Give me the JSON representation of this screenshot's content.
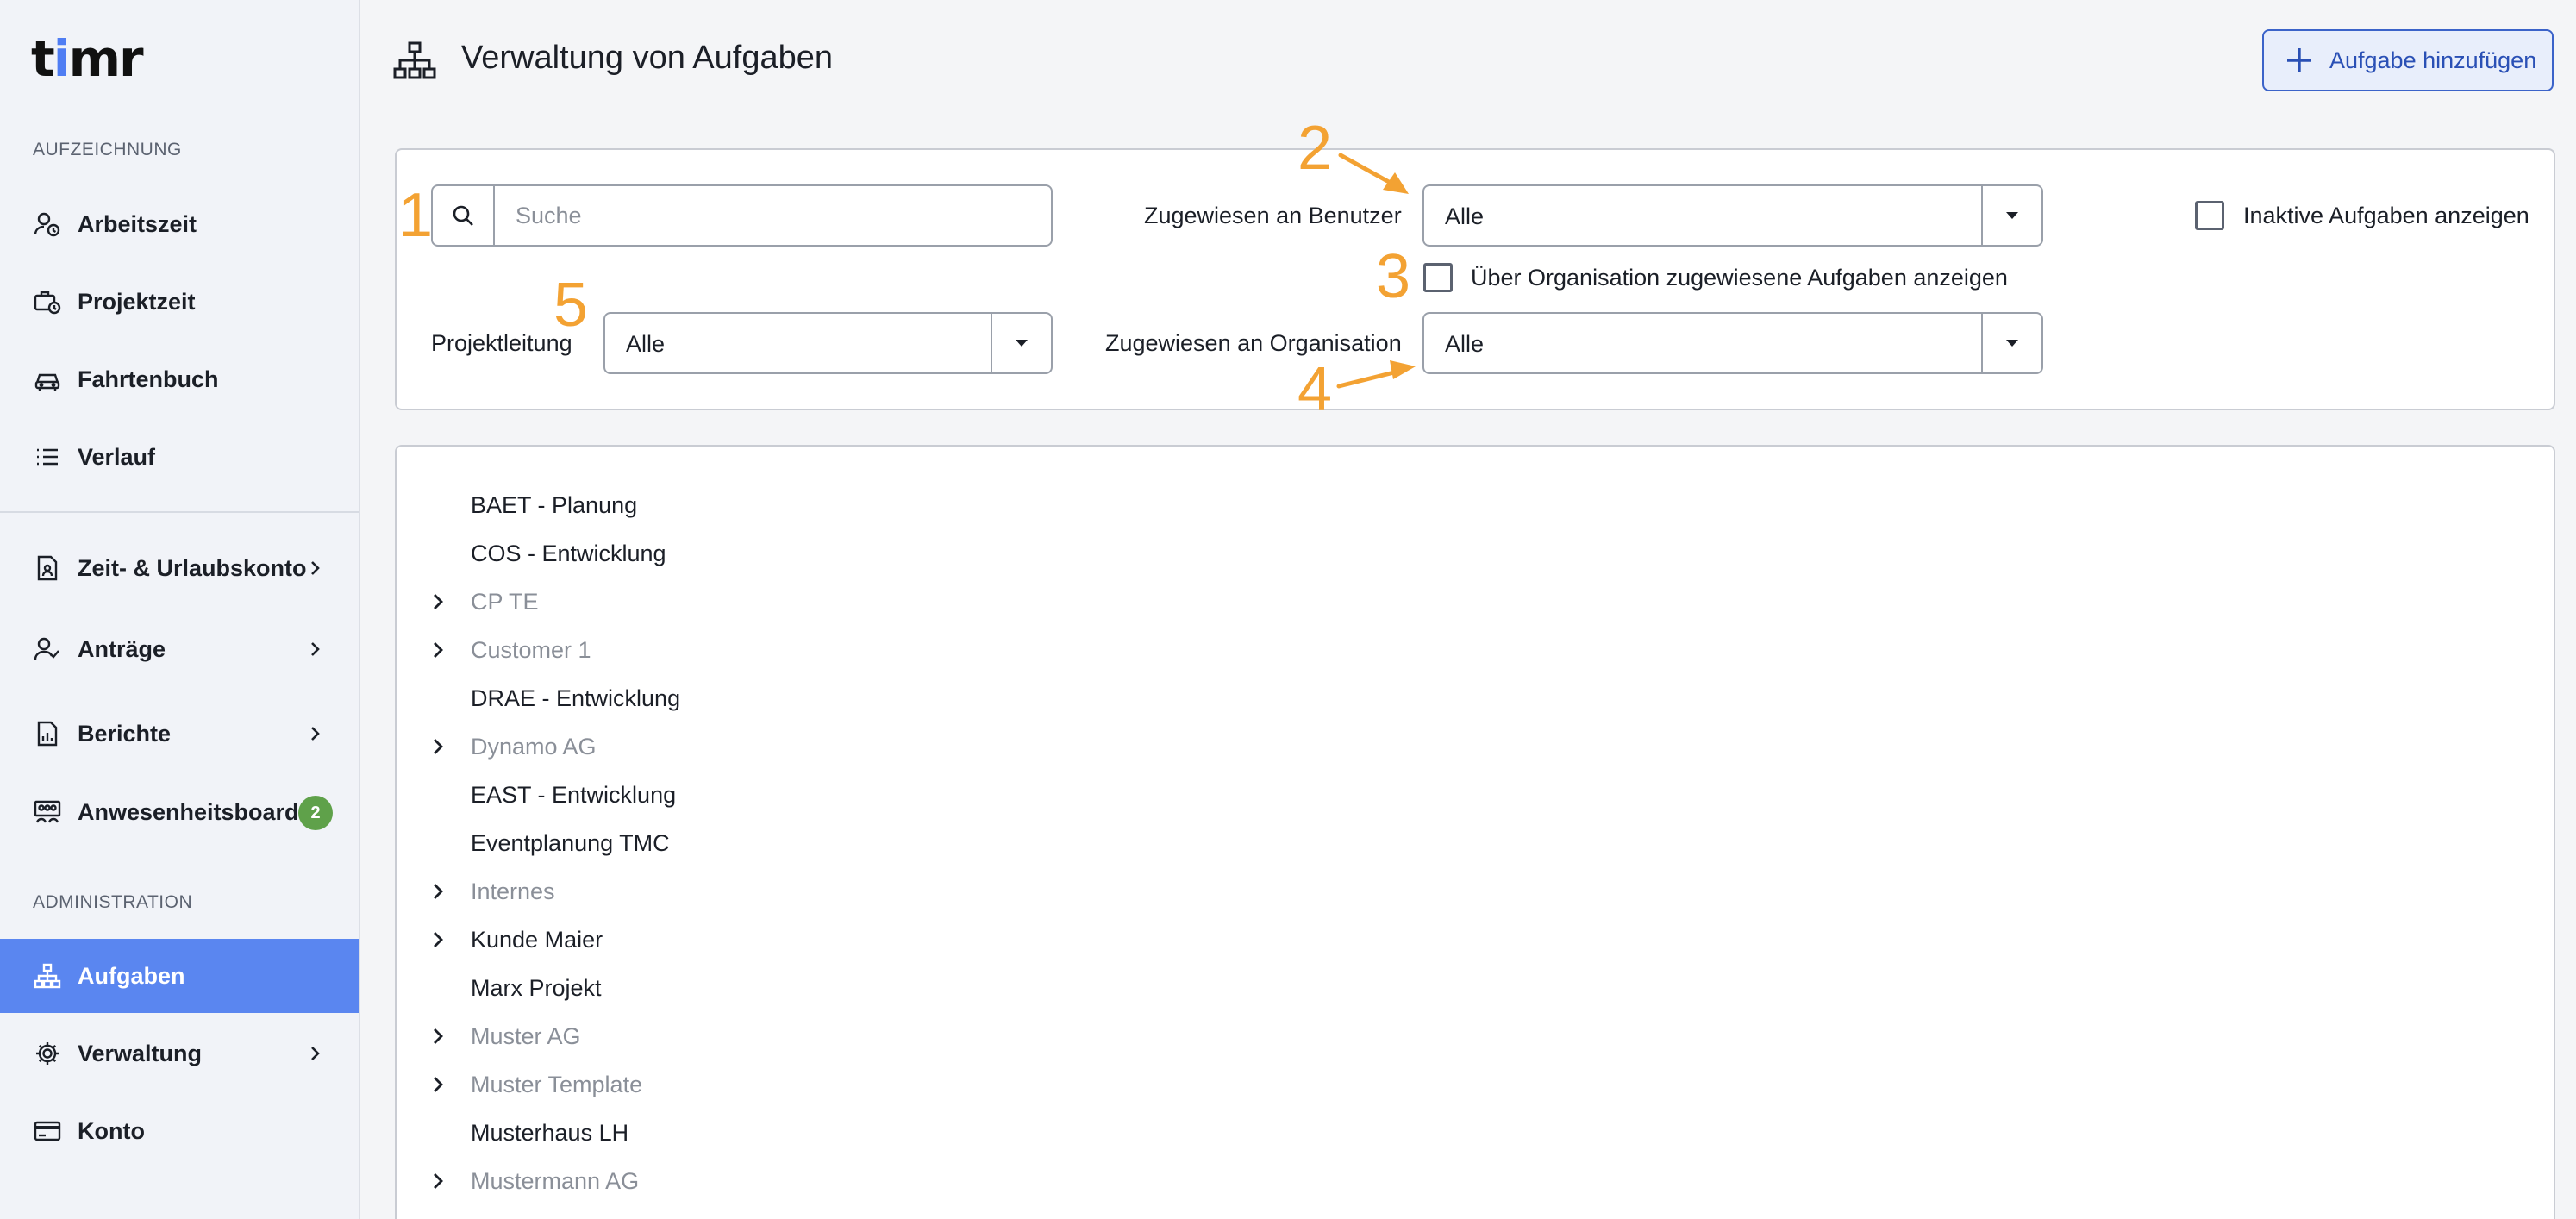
{
  "app": {
    "logo_text_a": "t",
    "logo_text_b": "i",
    "logo_text_c": "mr"
  },
  "sidebar": {
    "section_recording": "AUFZEICHNUNG",
    "section_admin": "ADMINISTRATION",
    "items": [
      {
        "label": "Arbeitszeit",
        "icon": "user-clock-icon"
      },
      {
        "label": "Projektzeit",
        "icon": "briefcase-clock-icon"
      },
      {
        "label": "Fahrtenbuch",
        "icon": "car-icon"
      },
      {
        "label": "Verlauf",
        "icon": "list-icon"
      },
      {
        "label": "Zeit- & Urlaubskonto",
        "icon": "document-user-icon"
      },
      {
        "label": "Anträge",
        "icon": "user-check-icon"
      },
      {
        "label": "Berichte",
        "icon": "report-icon"
      },
      {
        "label": "Anwesenheitsboard",
        "icon": "presence-board-icon",
        "badge": "2"
      },
      {
        "label": "Aufgaben",
        "icon": "hierarchy-icon",
        "active": true
      },
      {
        "label": "Verwaltung",
        "icon": "gear-icon"
      },
      {
        "label": "Konto",
        "icon": "credit-card-icon"
      }
    ]
  },
  "header": {
    "title": "Verwaltung von Aufgaben",
    "add_button": "Aufgabe hinzufügen"
  },
  "filters": {
    "search_placeholder": "Suche",
    "search_value": "",
    "assigned_user_label": "Zugewiesen an Benutzer",
    "assigned_user_value": "Alle",
    "inactive_label": "Inaktive Aufgaben anzeigen",
    "inactive_checked": false,
    "org_tasks_label": "Über Organisation zugewiesene Aufgaben anzeigen",
    "org_tasks_checked": false,
    "project_lead_label": "Projektleitung",
    "project_lead_value": "Alle",
    "assigned_org_label": "Zugewiesen an Organisation",
    "assigned_org_value": "Alle"
  },
  "annotations": {
    "n1": "1",
    "n2": "2",
    "n3": "3",
    "n4": "4",
    "n5": "5"
  },
  "tree": [
    {
      "label": "BAET - Planung",
      "expandable": false,
      "muted": false
    },
    {
      "label": "COS - Entwicklung",
      "expandable": false,
      "muted": false
    },
    {
      "label": "CP TE",
      "expandable": true,
      "muted": true
    },
    {
      "label": "Customer 1",
      "expandable": true,
      "muted": true
    },
    {
      "label": "DRAE - Entwicklung",
      "expandable": false,
      "muted": false
    },
    {
      "label": "Dynamo AG",
      "expandable": true,
      "muted": true
    },
    {
      "label": "EAST - Entwicklung",
      "expandable": false,
      "muted": false
    },
    {
      "label": "Eventplanung TMC",
      "expandable": false,
      "muted": false
    },
    {
      "label": "Internes",
      "expandable": true,
      "muted": true
    },
    {
      "label": "Kunde Maier",
      "expandable": true,
      "muted": false
    },
    {
      "label": "Marx Projekt",
      "expandable": false,
      "muted": false
    },
    {
      "label": "Muster AG",
      "expandable": true,
      "muted": true
    },
    {
      "label": "Muster Template",
      "expandable": true,
      "muted": true
    },
    {
      "label": "Musterhaus LH",
      "expandable": false,
      "muted": false
    },
    {
      "label": "Mustermann AG",
      "expandable": true,
      "muted": true
    }
  ]
}
